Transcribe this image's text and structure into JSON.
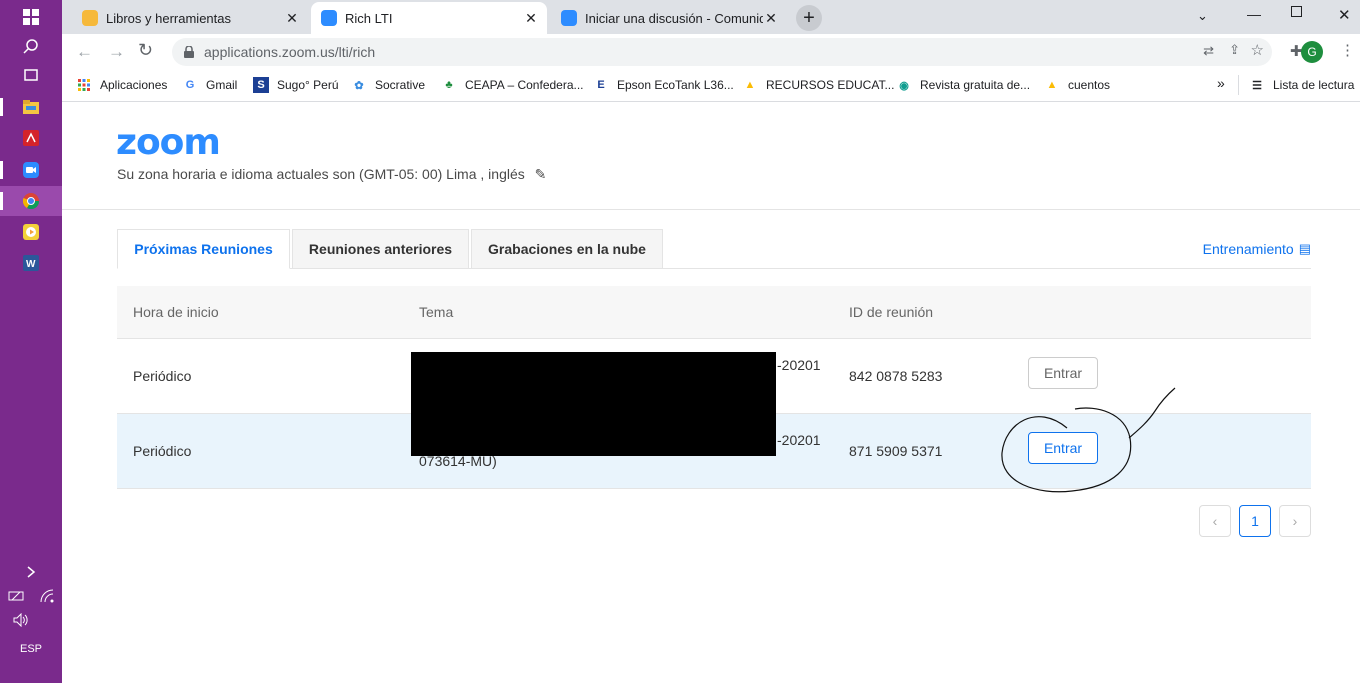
{
  "taskbar": {
    "language": "ESP"
  },
  "tabs": [
    {
      "title": "Libros y herramientas"
    },
    {
      "title": "Rich LTI"
    },
    {
      "title": "Iniciar una discusión - Comunida"
    }
  ],
  "address": {
    "url": "applications.zoom.us/lti/rich"
  },
  "bookmarks": [
    {
      "label": "Aplicaciones"
    },
    {
      "label": "Gmail"
    },
    {
      "label": "Sugo° Perú"
    },
    {
      "label": "Socrative"
    },
    {
      "label": "CEAPA – Confedera..."
    },
    {
      "label": "Epson EcoTank L36..."
    },
    {
      "label": "RECURSOS EDUCAT..."
    },
    {
      "label": "Revista gratuita de..."
    },
    {
      "label": "cuentos"
    }
  ],
  "reading_list": "Lista de lectura",
  "profile_initial": "G",
  "zoom": {
    "logo": "zoom",
    "timezone_text": "Su zona horaria e idioma actuales son (GMT-05: 00) Lima , inglés",
    "tabs": [
      "Próximas Reuniones",
      "Reuniones anteriores",
      "Grabaciones en la nube"
    ],
    "training": "Entrenamiento",
    "columns": [
      "Hora de inicio",
      "Tema",
      "ID de reunión"
    ],
    "rows": [
      {
        "start": "Periódico",
        "topic_tail": "-20201",
        "topic_line2": "",
        "meeting_id": "842 0878 5283",
        "action": "Entrar"
      },
      {
        "start": "Periódico",
        "topic_tail": "-20201",
        "topic_line2": "073614-MU)",
        "meeting_id": "871 5909 5371",
        "action": "Entrar"
      }
    ],
    "pagination": {
      "current": "1"
    }
  }
}
